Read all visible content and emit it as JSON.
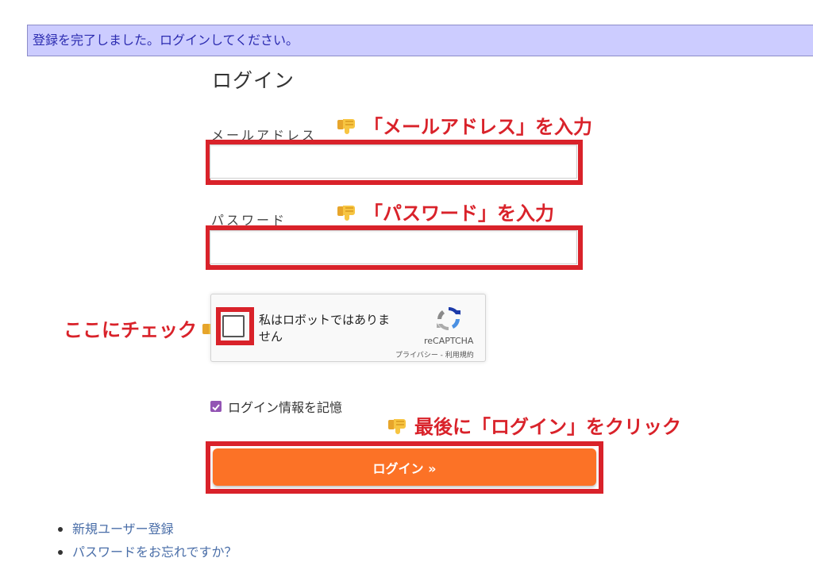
{
  "notice": "登録を完了しました。ログインしてください。",
  "title": "ログイン",
  "email": {
    "label": "メールアドレス",
    "value": ""
  },
  "password": {
    "label": "パスワード",
    "value": ""
  },
  "annotations": {
    "email": "「メールアドレス」を入力",
    "password": "「パスワード」を入力",
    "captcha": "ここにチェック",
    "login": "最後に「ログイン」をクリック"
  },
  "recaptcha": {
    "text": "私はロボットではありません",
    "brand": "reCAPTCHA",
    "terms": "プライバシー - 利用規約"
  },
  "remember": {
    "label": "ログイン情報を記憶",
    "checked": true
  },
  "login_button": "ログイン »",
  "links": [
    "新規ユーザー登録",
    "パスワードをお忘れですか？"
  ],
  "colors": {
    "annotation_red": "#d9222a",
    "button_orange": "#fc7226",
    "notice_bg": "#ccccff",
    "checkbox_purple": "#9354b4",
    "link_blue": "#4a6ea8"
  },
  "icons": [
    "pointing-hand-down-icon",
    "pointing-hand-right-icon",
    "recaptcha-logo-icon",
    "checkmark-icon"
  ]
}
